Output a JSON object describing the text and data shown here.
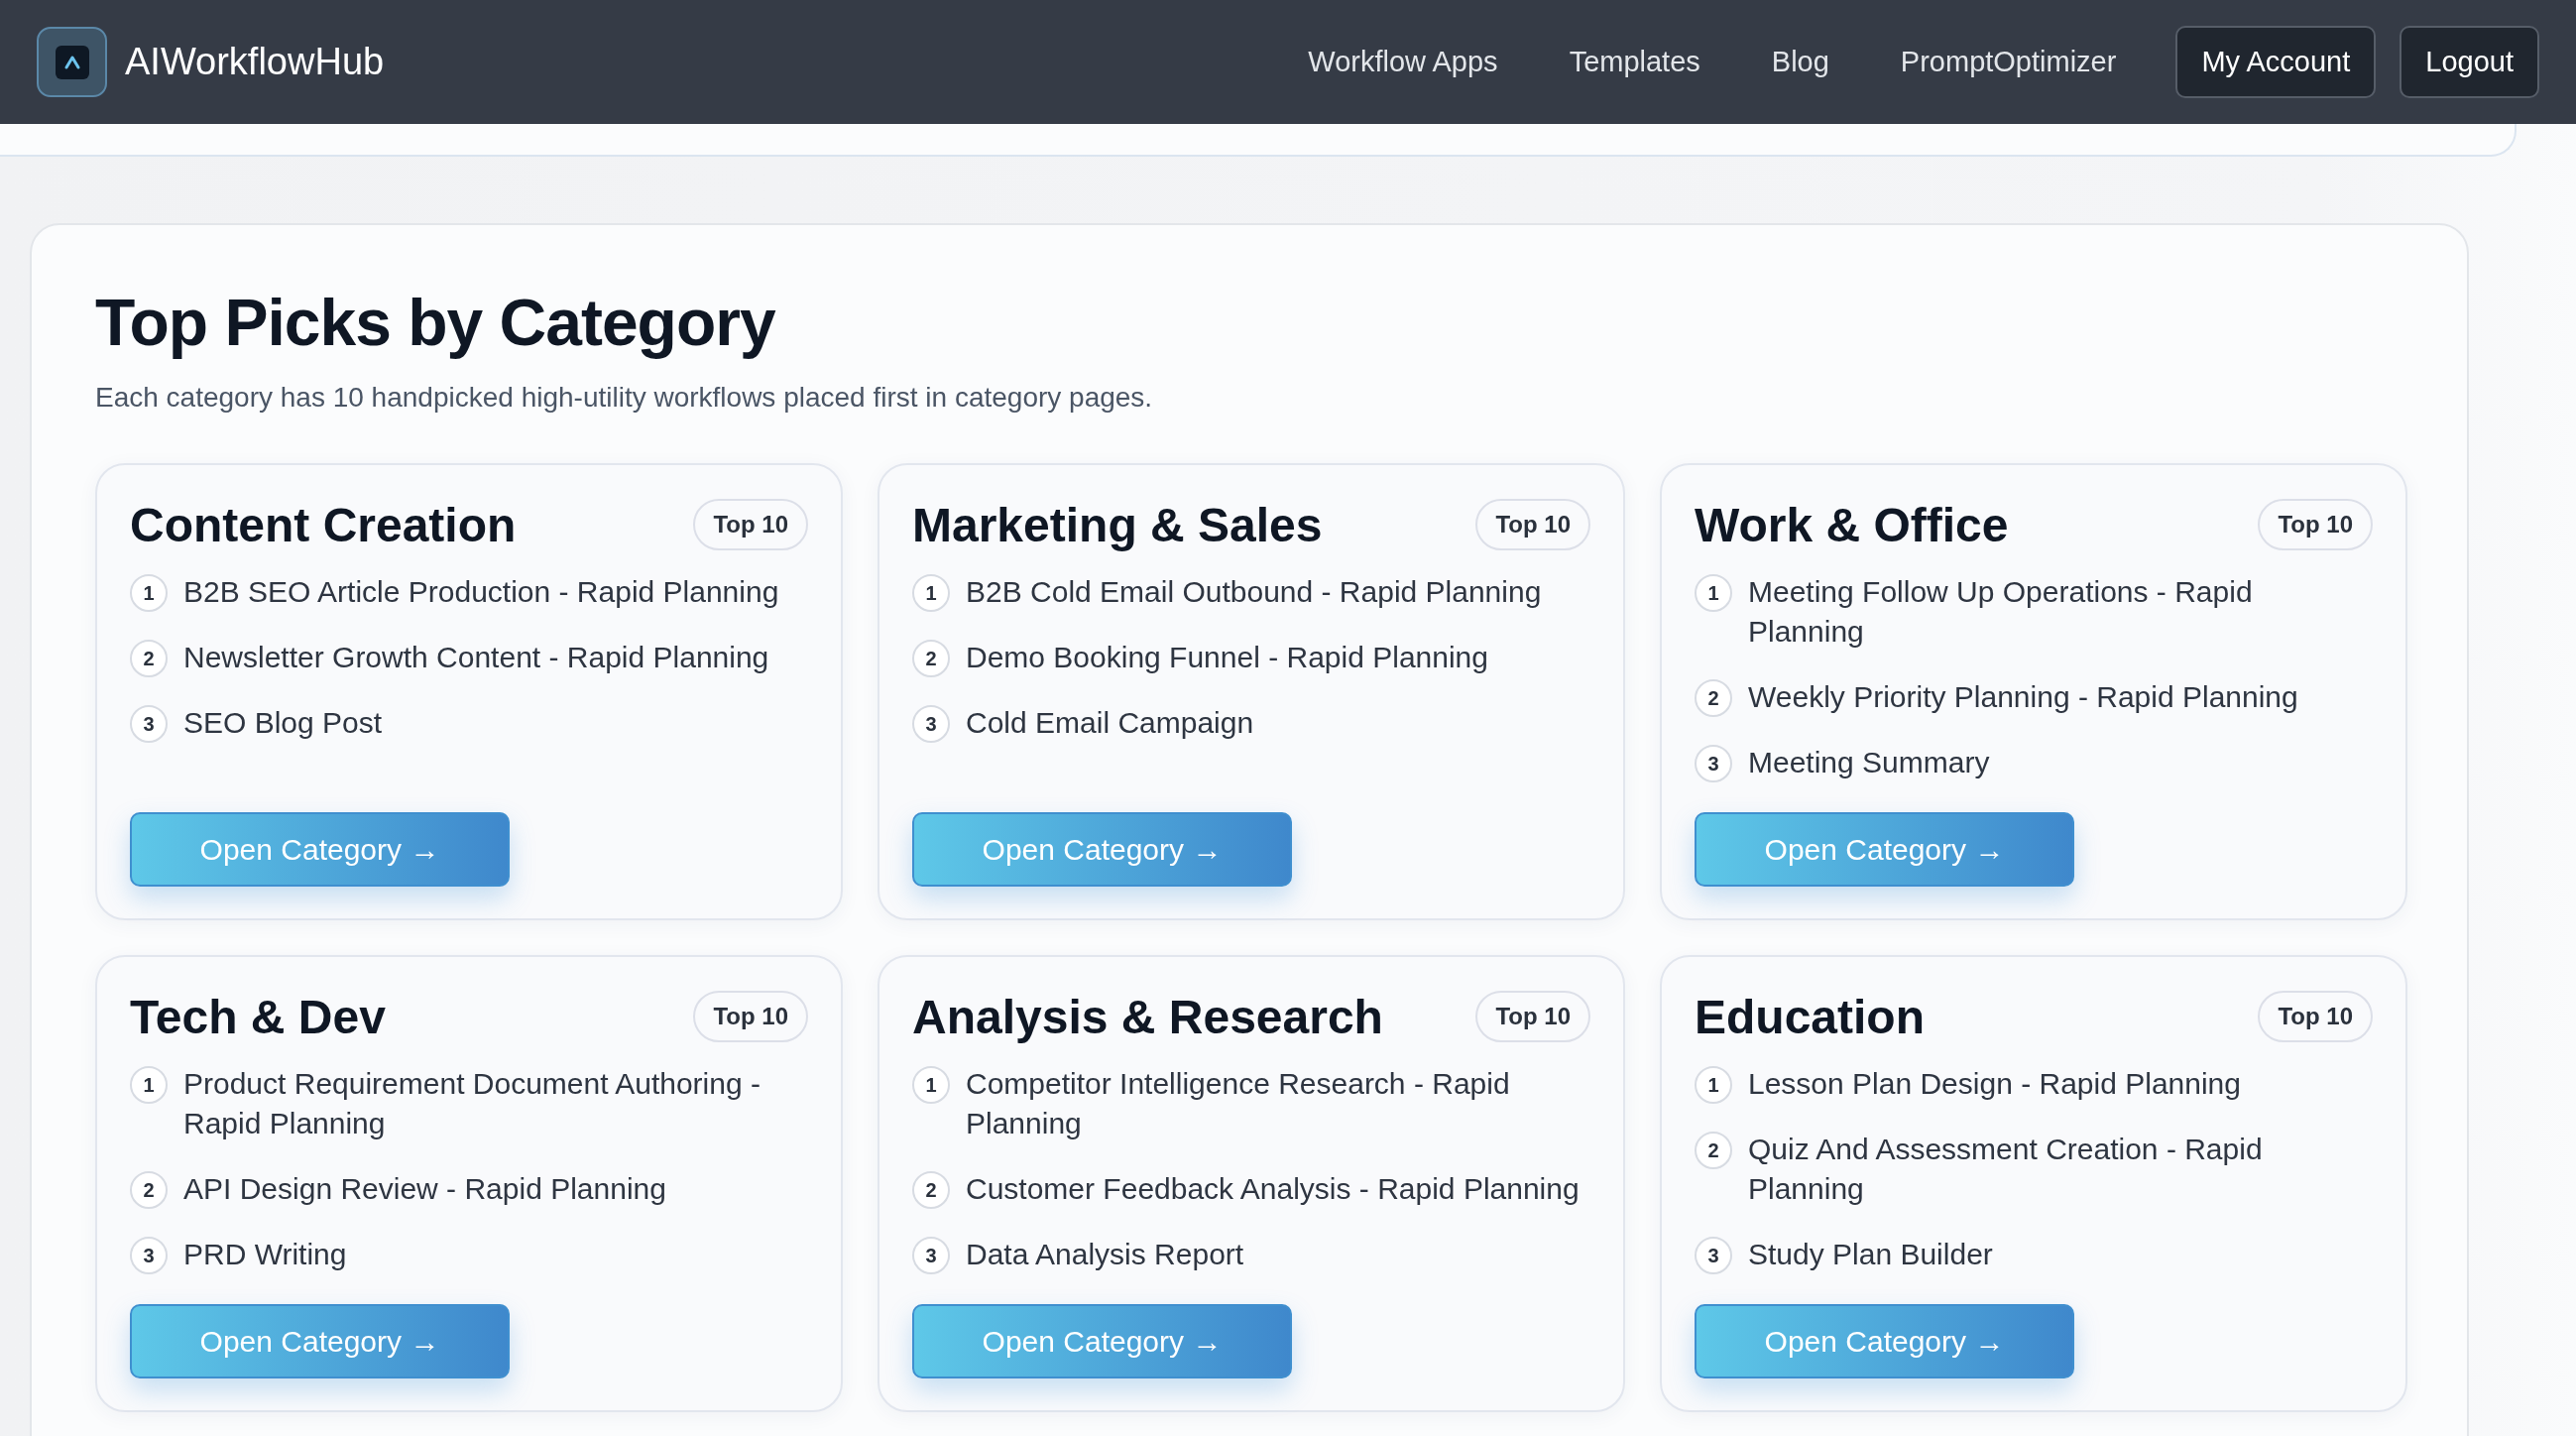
{
  "header": {
    "brand": "AIWorkflowHub",
    "nav": [
      {
        "label": "Workflow Apps"
      },
      {
        "label": "Templates"
      },
      {
        "label": "Blog"
      },
      {
        "label": "PromptOptimizer"
      }
    ],
    "account_buttons": [
      {
        "label": "My Account"
      },
      {
        "label": "Logout"
      }
    ]
  },
  "section": {
    "title": "Top Picks by Category",
    "subtitle": "Each category has 10 handpicked high-utility workflows placed first in category pages.",
    "categories": [
      {
        "title": "Content Creation",
        "badge": "Top 10",
        "items": [
          {
            "number": "1",
            "text": "B2B SEO Article Production - Rapid Planning"
          },
          {
            "number": "2",
            "text": "Newsletter Growth Content - Rapid Planning"
          },
          {
            "number": "3",
            "text": "SEO Blog Post"
          }
        ],
        "button": "Open Category →"
      },
      {
        "title": "Marketing & Sales",
        "badge": "Top 10",
        "items": [
          {
            "number": "1",
            "text": "B2B Cold Email Outbound - Rapid Planning"
          },
          {
            "number": "2",
            "text": "Demo Booking Funnel - Rapid Planning"
          },
          {
            "number": "3",
            "text": "Cold Email Campaign"
          }
        ],
        "button": "Open Category →"
      },
      {
        "title": "Work & Office",
        "badge": "Top 10",
        "items": [
          {
            "number": "1",
            "text": "Meeting Follow Up Operations - Rapid Planning"
          },
          {
            "number": "2",
            "text": "Weekly Priority Planning - Rapid Planning"
          },
          {
            "number": "3",
            "text": "Meeting Summary"
          }
        ],
        "button": "Open Category →"
      },
      {
        "title": "Tech & Dev",
        "badge": "Top 10",
        "items": [
          {
            "number": "1",
            "text": "Product Requirement Document Authoring - Rapid Planning"
          },
          {
            "number": "2",
            "text": "API Design Review - Rapid Planning"
          },
          {
            "number": "3",
            "text": "PRD Writing"
          }
        ],
        "button": "Open Category →"
      },
      {
        "title": "Analysis & Research",
        "badge": "Top 10",
        "items": [
          {
            "number": "1",
            "text": "Competitor Intelligence Research - Rapid Planning"
          },
          {
            "number": "2",
            "text": "Customer Feedback Analysis - Rapid Planning"
          },
          {
            "number": "3",
            "text": "Data Analysis Report"
          }
        ],
        "button": "Open Category →"
      },
      {
        "title": "Education",
        "badge": "Top 10",
        "items": [
          {
            "number": "1",
            "text": "Lesson Plan Design - Rapid Planning"
          },
          {
            "number": "2",
            "text": "Quiz And Assessment Creation - Rapid Planning"
          },
          {
            "number": "3",
            "text": "Study Plan Builder"
          }
        ],
        "button": "Open Category →"
      }
    ]
  }
}
